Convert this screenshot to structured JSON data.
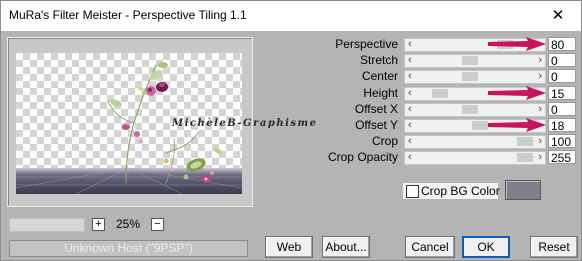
{
  "window": {
    "title": "MuRa's Filter Meister - Perspective Tiling 1.1",
    "close_glyph": "✕"
  },
  "preview": {
    "watermark": "MichèleB-Graphisme"
  },
  "zoom": {
    "plus": "+",
    "value": "25%",
    "minus": "−"
  },
  "host": {
    "text": "Unknown Host (\"9PSP\")"
  },
  "params": [
    {
      "label": "Perspective",
      "value": "80",
      "level": 0.8
    },
    {
      "label": "Stretch",
      "value": "0",
      "level": 0.45
    },
    {
      "label": "Center",
      "value": "0",
      "level": 0.45
    },
    {
      "label": "Height",
      "value": "15",
      "level": 0.15
    },
    {
      "label": "Offset X",
      "value": "0",
      "level": 0.45
    },
    {
      "label": "Offset Y",
      "value": "18",
      "level": 0.55
    },
    {
      "label": "Crop",
      "value": "100",
      "level": 1.0
    },
    {
      "label": "Crop Opacity",
      "value": "255",
      "level": 1.0
    }
  ],
  "crop_bg": {
    "label": "Crop BG Color",
    "checked": false,
    "swatch_color": "#817f8e"
  },
  "buttons": {
    "web": "Web",
    "about": "About...",
    "cancel": "Cancel",
    "ok": "OK",
    "reset": "Reset"
  },
  "colors": {
    "marker_arrow": "#c8145a"
  },
  "icons": {
    "slider_left": "chevron-left-icon",
    "slider_right": "chevron-right-icon"
  }
}
